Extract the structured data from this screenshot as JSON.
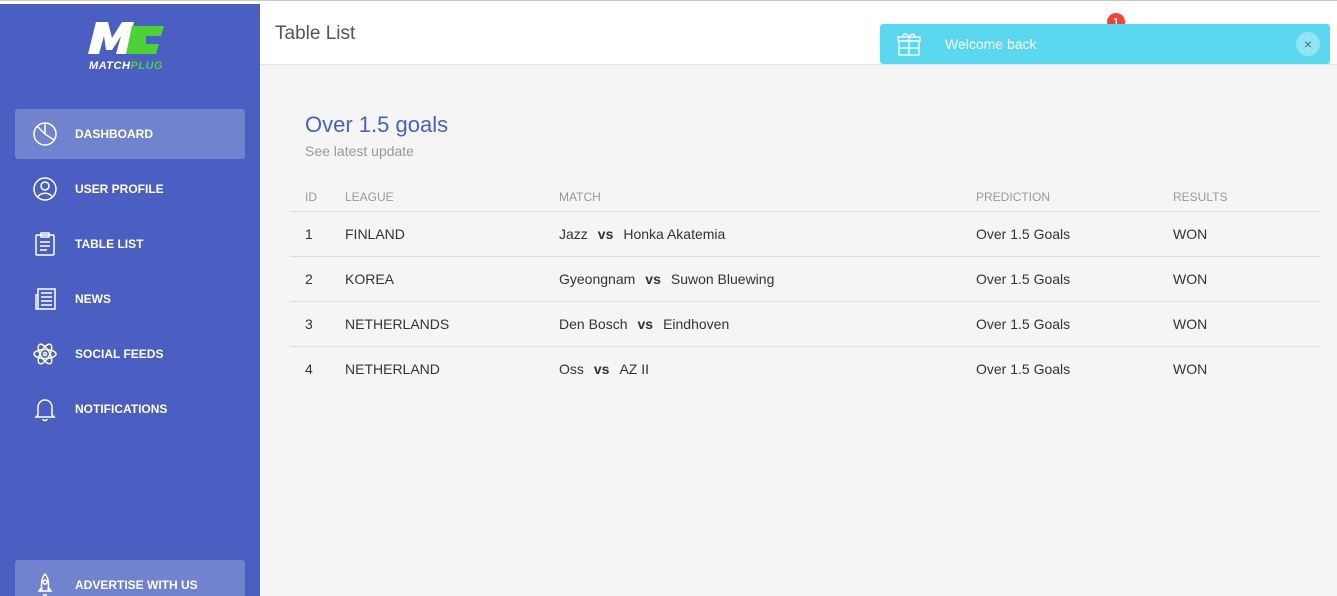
{
  "app": {
    "logo_mark": "MC",
    "logo_text_a": "MATCH",
    "logo_text_b": "PLUG"
  },
  "sidebar": {
    "items": [
      {
        "label": "DASHBOARD",
        "icon": "pie-chart-icon",
        "active": true
      },
      {
        "label": "USER PROFILE",
        "icon": "user-icon",
        "active": false
      },
      {
        "label": "TABLE LIST",
        "icon": "clipboard-icon",
        "active": false
      },
      {
        "label": "NEWS",
        "icon": "newspaper-icon",
        "active": false
      },
      {
        "label": "SOCIAL FEEDS",
        "icon": "atom-icon",
        "active": false
      },
      {
        "label": "NOTIFICATIONS",
        "icon": "bell-icon",
        "active": false
      }
    ],
    "advertise": {
      "label": "ADVERTISE WITH US",
      "icon": "rocket-icon"
    }
  },
  "header": {
    "title": "Table List",
    "notification_count": "1"
  },
  "toast": {
    "message": "Welcome back",
    "icon": "gift-icon",
    "close": "×"
  },
  "card": {
    "title": "Over 1.5 goals",
    "subtitle": "See latest update"
  },
  "table": {
    "headers": [
      "ID",
      "LEAGUE",
      "MATCH",
      "PREDICTION",
      "RESULTS"
    ],
    "vs_label": "vs",
    "rows": [
      {
        "id": "1",
        "league": "FINLAND",
        "home": "Jazz",
        "away": "Honka Akatemia",
        "prediction": "Over 1.5 Goals",
        "result": "WON"
      },
      {
        "id": "2",
        "league": "KOREA",
        "home": "Gyeongnam",
        "away": "Suwon Bluewing",
        "prediction": "Over 1.5 Goals",
        "result": "WON"
      },
      {
        "id": "3",
        "league": "NETHERLANDS",
        "home": "Den Bosch",
        "away": "Eindhoven",
        "prediction": "Over 1.5 Goals",
        "result": "WON"
      },
      {
        "id": "4",
        "league": "NETHERLAND",
        "home": "Oss",
        "away": "AZ II",
        "prediction": "Over 1.5 Goals",
        "result": "WON"
      }
    ]
  },
  "colors": {
    "sidebar": "#4a5fc1",
    "accent_green": "#4cd137",
    "toast": "#5bd7ef",
    "badge": "#f44336"
  }
}
